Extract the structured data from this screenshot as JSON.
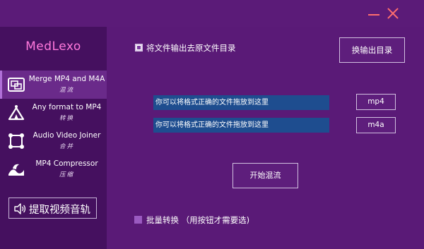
{
  "app": {
    "name": "MedLexo"
  },
  "sidebar": {
    "items": [
      {
        "title": "Merge MP4 and M4A",
        "subtitle": "混流",
        "icon": "merge-icon"
      },
      {
        "title": "Any format to MP4",
        "subtitle": "转换",
        "icon": "convert-icon"
      },
      {
        "title": "Audio Video Joiner",
        "subtitle": "合并",
        "icon": "joiner-icon"
      },
      {
        "title": "MP4 Compressor",
        "subtitle": "压缩",
        "icon": "compress-icon"
      }
    ],
    "active_index": 0,
    "extract_audio_label": "提取视频音轨"
  },
  "main": {
    "output_to_source_label": "将文件输出去原文件目录",
    "output_to_source_checked": true,
    "change_output_dir_label": "换输出目录",
    "drop_zone_1_text": "你可以将格式正确的文件拖放到这里",
    "drop_zone_2_text": "你可以将格式正确的文件拖放到这里",
    "format_1_label": "mp4",
    "format_2_label": "m4a",
    "start_button_label": "开始混流",
    "batch_label": "批量转换 （用按钮才需要选)",
    "batch_checked": false
  },
  "colors": {
    "background": "#5a1a77",
    "sidebar": "#45105f",
    "active_item": "#6a2a8a",
    "logo": "#ff78dc",
    "drop_zone": "#1e4d8f",
    "window_controls": "#ff6e6e"
  }
}
